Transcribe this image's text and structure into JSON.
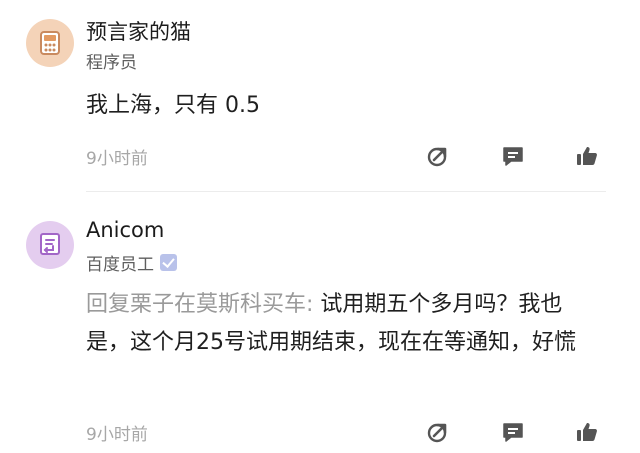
{
  "comments": [
    {
      "user": {
        "name": "预言家的猫",
        "role": "程序员"
      },
      "text": "我上海，只有 0.5",
      "time": "9小时前",
      "avatar_icon": "calculator-icon",
      "avatar_color": "#f4d3b8"
    },
    {
      "user": {
        "name": "Anicom",
        "role": "百度员工",
        "verified": true
      },
      "reply_prefix": "回复栗子在莫斯科买车: ",
      "text": "试用期五个多月吗？我也是，这个月25号试用期结束，现在在等通知，好慌",
      "time": "9小时前",
      "avatar_icon": "document-icon",
      "avatar_color": "#e4cdef"
    }
  ],
  "icons": {
    "share": "share-arrow-icon",
    "comment": "comment-bubble-icon",
    "like": "thumbs-up-icon"
  },
  "colors": {
    "icon": "#555555",
    "time": "#a7a7a7",
    "reply_prefix": "#9a9a9a",
    "verified": "#b9c2ea"
  }
}
